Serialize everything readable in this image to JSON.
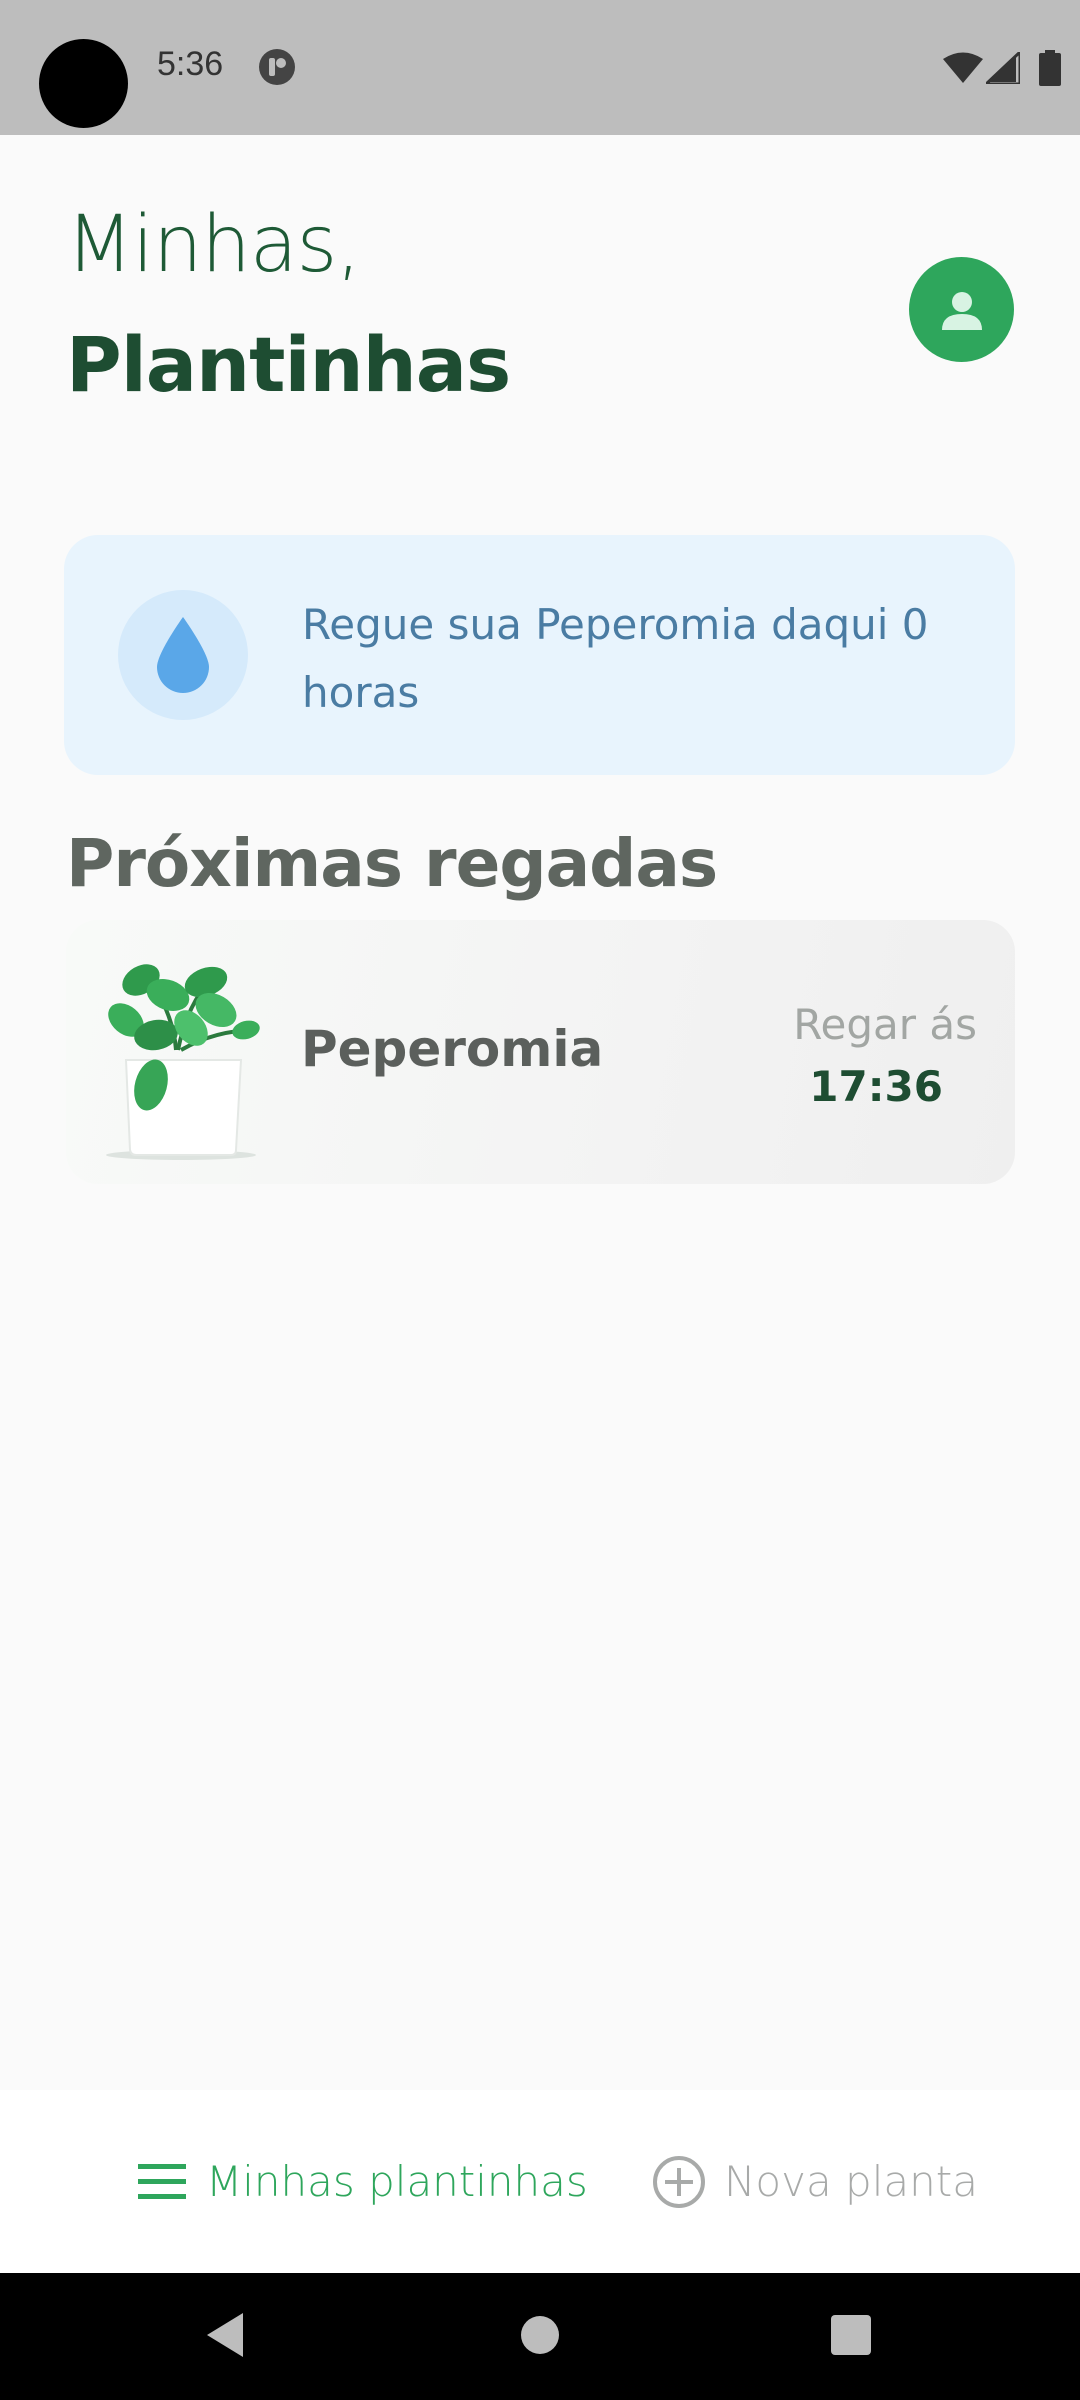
{
  "status_bar": {
    "time": "5:36"
  },
  "header": {
    "greeting": "Minhas,",
    "title": "Plantinhas"
  },
  "reminder": {
    "text": "Regue sua Peperomia daqui 0 horas"
  },
  "upcoming": {
    "title": "Próximas regadas",
    "items": [
      {
        "name": "Peperomia",
        "water_label": "Regar ás",
        "water_time": "17:36"
      }
    ]
  },
  "bottom_nav": {
    "items": [
      {
        "label": "Minhas plantinhas",
        "icon": "menu-icon",
        "active": true
      },
      {
        "label": "Nova planta",
        "icon": "add-circle-icon",
        "active": false
      }
    ]
  },
  "colors": {
    "primary_green": "#2ea65c",
    "dark_green": "#1e4d32",
    "reminder_bg": "#e8f4fd",
    "reminder_text": "#4a7ca3"
  }
}
